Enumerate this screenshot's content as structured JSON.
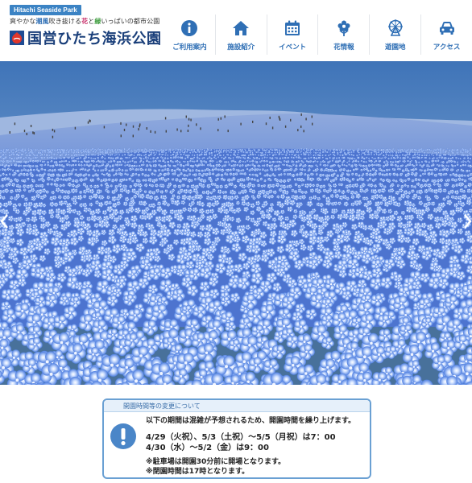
{
  "header": {
    "en_badge": "Hitachi Seaside Park",
    "tagline": {
      "part1": "爽やかな",
      "part2": "潮風",
      "part3": "吹き抜ける",
      "part4": "花",
      "part5": "と",
      "part6": "緑",
      "part7": "いっぱいの都市公園"
    },
    "park_name": "国営ひたち海浜公園"
  },
  "nav": {
    "items": [
      {
        "label": "ご利用案内",
        "icon": "info-icon"
      },
      {
        "label": "施設紹介",
        "icon": "home-icon"
      },
      {
        "label": "イベント",
        "icon": "calendar-icon"
      },
      {
        "label": "花情報",
        "icon": "flower-icon"
      },
      {
        "label": "遊園地",
        "icon": "ferris-wheel-icon"
      },
      {
        "label": "アクセス",
        "icon": "car-icon"
      }
    ]
  },
  "notice": {
    "title": "開園時間等の変更について",
    "intro": "以下の期間は混雑が予想されるため、開園時間を繰り上げます。",
    "date_line_1": "4/29（火祝）、5/3（土祝）〜5/5（月祝）は7：00",
    "date_line_2": "4/30（水）〜5/2（金）は9：00",
    "note_1": "※駐車場は開園30分前に開場となります。",
    "note_2": "※閉園時間は17時となります。"
  },
  "colors": {
    "brand_blue": "#2f6fb5",
    "notice_border": "#6aa0d3",
    "flower_blue": "#4a78d8"
  }
}
